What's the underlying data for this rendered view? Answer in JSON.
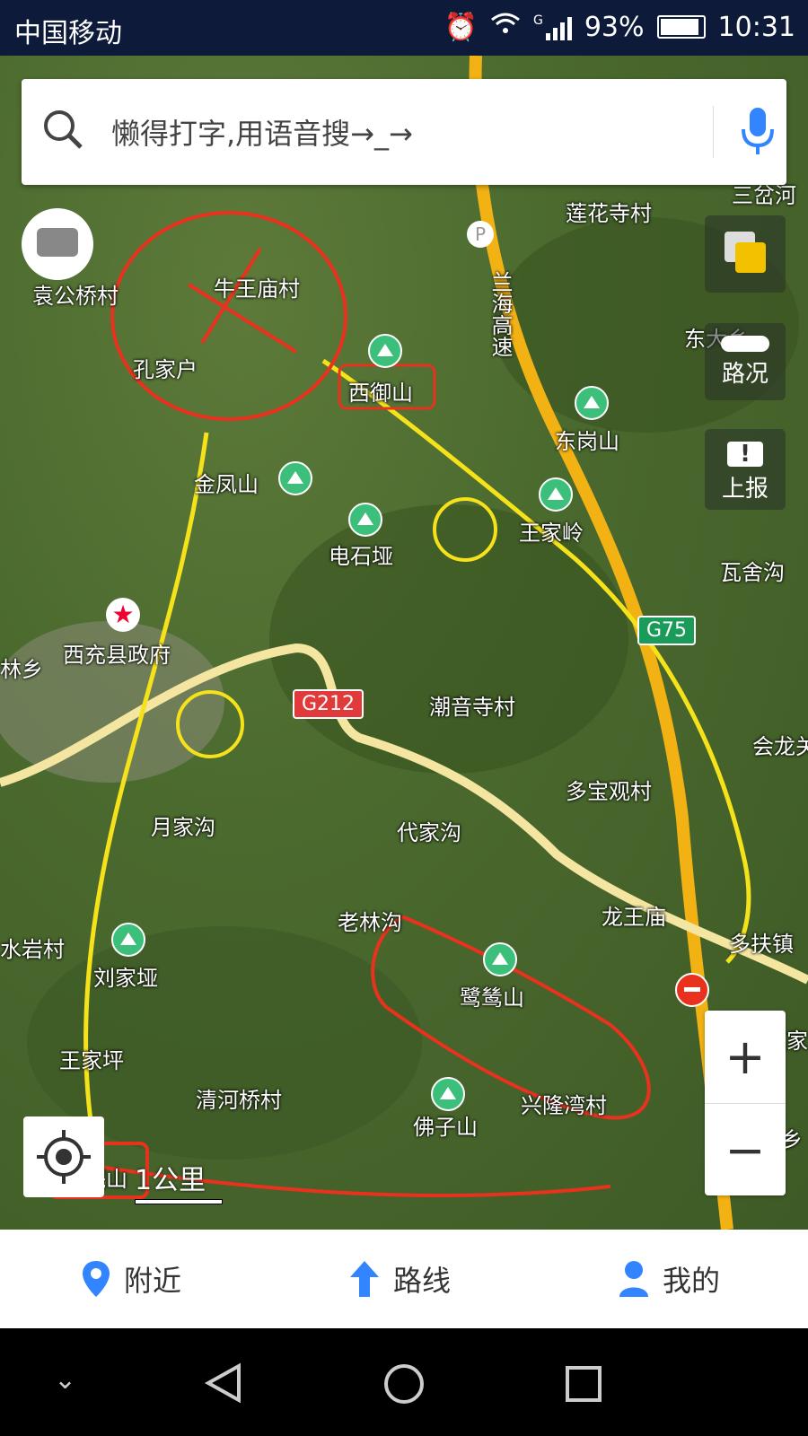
{
  "status_bar": {
    "carrier": "中国移动",
    "signal": "G",
    "battery": "93%",
    "time": "10:31"
  },
  "search": {
    "placeholder": "懒得打字,用语音搜→_→"
  },
  "side_controls": {
    "traffic_label": "路况",
    "report_label": "上报"
  },
  "map_labels": {
    "yuangongqiao": "袁公桥村",
    "niuwangmiao": "牛王庙村",
    "kongjiahu": "孔家户",
    "lianhuasi": "莲花寺村",
    "xiyushan": "西御山",
    "donggangshan": "东岗山",
    "jinfengshan": "金凤山",
    "dianshiya": "电石垭",
    "wangjialing": "王家岭",
    "washegou": "瓦舍沟",
    "dongda": "东大乡",
    "xichong_gov": "西充县政府",
    "linxiang": "林乡",
    "chaoyinsi": "潮音寺村",
    "huilong": "会龙关",
    "duobaoguan": "多宝观村",
    "yuejiagou": "月家沟",
    "daijiagou": "代家沟",
    "laolingou": "老林沟",
    "longwangmiao": "龙王庙",
    "duofu": "多扶镇",
    "shuiyan": "水岩村",
    "liujiaya": "刘家垭",
    "lusishan": "鹭鸶山",
    "zhaojia": "赵家",
    "wangjiaping": "王家坪",
    "qinghe": "清河桥村",
    "xinglongwan": "兴隆湾村",
    "foziShan": "佛子山",
    "nanminshan": "南岷山",
    "mufu": "木阜乡",
    "lanhai": "兰海高速",
    "sanbao": "三岔河"
  },
  "road_badges": {
    "g75": "G75",
    "g212": "G212"
  },
  "scale_label": "1公里",
  "bottom_nav": [
    {
      "label": "附近"
    },
    {
      "label": "路线"
    },
    {
      "label": "我的"
    }
  ],
  "colors": {
    "status_bg": "#0d1a3a",
    "accent_blue": "#3385ff",
    "annotation_yellow": "#f5e21a",
    "annotation_red": "#e8321e"
  }
}
